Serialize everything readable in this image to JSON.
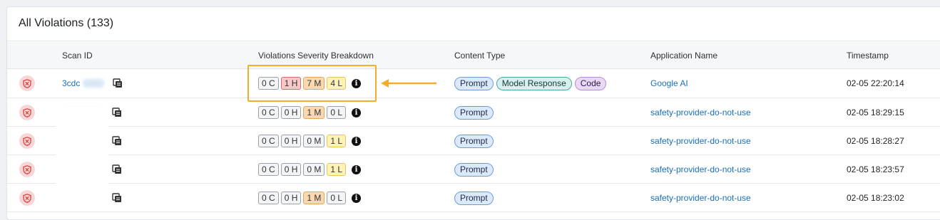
{
  "panel": {
    "title": "All Violations (133)"
  },
  "table": {
    "headers": {
      "scan_id": "Scan ID",
      "severity": "Violations Severity Breakdown",
      "content_type": "Content Type",
      "app_name": "Application Name",
      "timestamp": "Timestamp"
    },
    "rows": [
      {
        "scan_id": "3cdc",
        "c": "0 C",
        "h": "1 H",
        "m": "7 M",
        "l": "4 L",
        "content": [
          "Prompt",
          "Model Response",
          "Code"
        ],
        "app": "Google AI",
        "timestamp": "02-05 22:20:14"
      },
      {
        "scan_id": "",
        "c": "0 C",
        "h": "0 H",
        "m": "1 M",
        "l": "0 L",
        "content": [
          "Prompt"
        ],
        "app": "safety-provider-do-not-use",
        "timestamp": "02-05 18:29:15"
      },
      {
        "scan_id": "",
        "c": "0 C",
        "h": "0 H",
        "m": "0 M",
        "l": "1 L",
        "content": [
          "Prompt"
        ],
        "app": "safety-provider-do-not-use",
        "timestamp": "02-05 18:28:27"
      },
      {
        "scan_id": "",
        "c": "0 C",
        "h": "0 H",
        "m": "0 M",
        "l": "1 L",
        "content": [
          "Prompt"
        ],
        "app": "safety-provider-do-not-use",
        "timestamp": "02-05 18:23:57"
      },
      {
        "scan_id": "",
        "c": "0 C",
        "h": "0 H",
        "m": "1 M",
        "l": "0 L",
        "content": [
          "Prompt"
        ],
        "app": "safety-provider-do-not-use",
        "timestamp": "02-05 18:23:02"
      }
    ]
  },
  "colors": {
    "highlight": "#f2ae2b",
    "link": "#1a6fb8"
  },
  "icons": {
    "status": "shield-x-icon",
    "copy": "copy-icon",
    "info": "info-icon"
  }
}
